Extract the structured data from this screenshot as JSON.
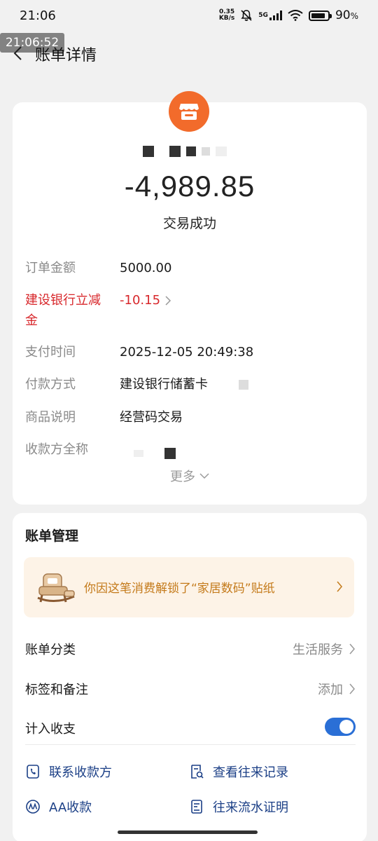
{
  "status_bar": {
    "time": "21:06",
    "net_speed_top": "0.35",
    "net_speed_bottom": "KB/s",
    "network": "5G",
    "battery": "90",
    "battery_unit": "%"
  },
  "overlay_time": "21:06:52",
  "header": {
    "title": "账单详情"
  },
  "transaction": {
    "amount": "-4,989.85",
    "status": "交易成功",
    "details": [
      {
        "label": "订单金额",
        "value": "5000.00"
      },
      {
        "label": "建设银行立减\n金",
        "value": "-10.15"
      },
      {
        "label": "支付时间",
        "value": "2025-12-05 20:49:38"
      },
      {
        "label": "付款方式",
        "value": "建设银行储蓄卡"
      },
      {
        "label": "商品说明",
        "value": "经营码交易"
      },
      {
        "label": "收款方全称",
        "value": ""
      }
    ],
    "more": "更多"
  },
  "manage": {
    "title": "账单管理",
    "sticker_text": "你因这笔消费解锁了“家居数码”贴纸",
    "category_label": "账单分类",
    "category_value": "生活服务",
    "tags_label": "标签和备注",
    "tags_value": "添加",
    "include_label": "计入收支",
    "include_enabled": true,
    "actions": [
      {
        "label": "联系收款方",
        "icon": "phone-icon"
      },
      {
        "label": "查看往来记录",
        "icon": "search-doc-icon"
      },
      {
        "label": "AA收款",
        "icon": "aa-icon"
      },
      {
        "label": "往来流水证明",
        "icon": "doc-icon"
      }
    ]
  },
  "colors": {
    "accent_blue": "#2a6fd6",
    "discount_red": "#d8282c",
    "merchant_orange": "#f26b2b",
    "banner_text": "#c47a1a"
  }
}
